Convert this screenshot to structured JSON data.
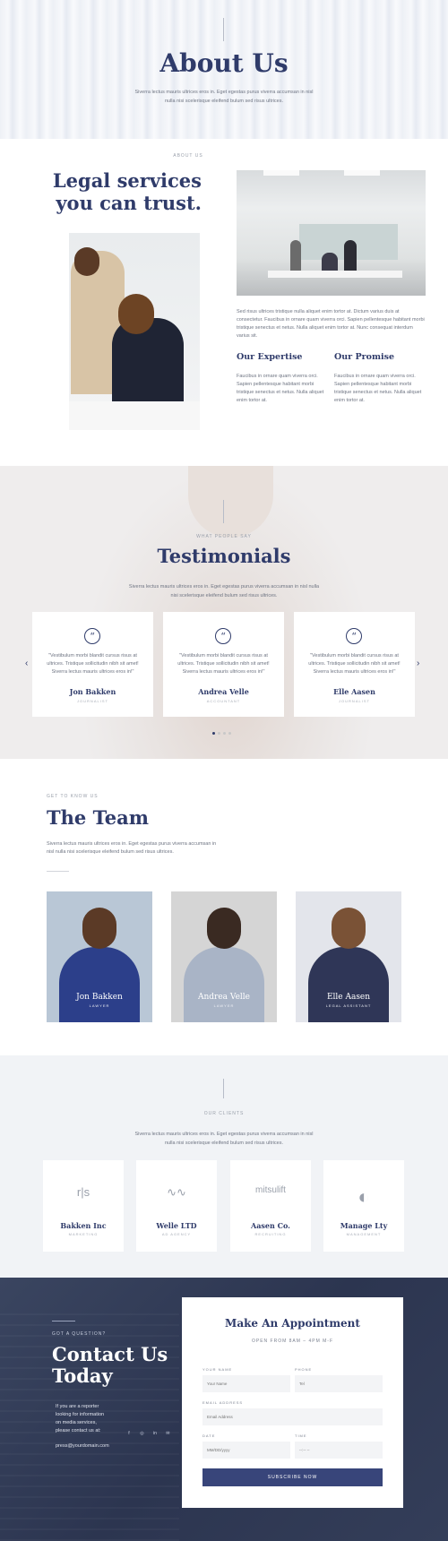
{
  "hero": {
    "title": "About Us",
    "text": "Siverra lectus mauris ultrices eros in. Eget egestas purus viverra accumsan in nisl nulla nisi scelerisque eleifend bulum sed risus ultrices."
  },
  "about": {
    "label": "ABOUT US",
    "title": "Legal services you can trust.",
    "body": "Sed risus ultrices tristique nulla aliquet enim tortor at. Dictum varius duis at consectetur. Faucibus in ornare quam viverra orci. Sapien pellentesque habitant morbi tristique senectus et netus. Nulla aliquet enim tortor at. Nunc consequat interdum varius sit.",
    "features": [
      {
        "title": "Our Expertise",
        "text": "Faucibus in ornare quam viverra orci. Sapien pellentesque habitant morbi tristique senectus et netus. Nulla aliquet enim tortor at."
      },
      {
        "title": "Our Promise",
        "text": "Faucibus in ornare quam viverra orci. Sapien pellentesque habitant morbi tristique senectus et netus. Nulla aliquet enim tortor at."
      }
    ]
  },
  "testimonials": {
    "label": "WHAT PEOPLE SAY",
    "title": "Testimonials",
    "subtitle": "Siverra lectus mauris ultrices eros in. Eget egestas purus viverra accumsan in nisl nulla nisi scelerisque eleifend bulum sed risus ultrices.",
    "quote_glyph": "“",
    "prev_arrow": "‹",
    "next_arrow": "›",
    "items": [
      {
        "quote": "\"Vestibulum morbi blandit cursus risus at ultrices. Tristique sollicitudin nibh sit amet! Siverra lectus mauris ultrices eros in!\"",
        "name": "Jon Bakken",
        "role": "JOURNALIST"
      },
      {
        "quote": "\"Vestibulum morbi blandit cursus risus at ultrices. Tristique sollicitudin nibh sit amet! Siverra lectus mauris ultrices eros in!\"",
        "name": "Andrea Velle",
        "role": "ACCOUNTANT"
      },
      {
        "quote": "\"Vestibulum morbi blandit cursus risus at ultrices. Tristique sollicitudin nibh sit amet! Siverra lectus mauris ultrices eros in!\"",
        "name": "Elle Aasen",
        "role": "JOURNALIST"
      }
    ]
  },
  "team": {
    "label": "GET TO KNOW US",
    "title": "The Team",
    "subtitle": "Siverra lectus mauris ultrices eros in. Eget egestas purus viverra accumsan in nisl nulla nisi scelerisque eleifend bulum sed risus ultrices.",
    "members": [
      {
        "name": "Jon Bakken",
        "role": "LAWYER"
      },
      {
        "name": "Andrea Velle",
        "role": "LAWYER"
      },
      {
        "name": "Elle Aasen",
        "role": "LEGAL ASSISTANT"
      }
    ]
  },
  "clients": {
    "label": "OUR CLIENTS",
    "subtitle": "Siverra lectus mauris ultrices eros in. Eget egestas purus viverra accumsan in nisl nulla nisi scelerisque eleifend bulum sed risus ultrices.",
    "items": [
      {
        "logo": "r|s",
        "name": "Bakken Inc",
        "type": "MARKETING"
      },
      {
        "logo": "∿∿",
        "name": "Welle LTD",
        "type": "AD AGENCY"
      },
      {
        "logo": "mitsulift",
        "name": "Aasen Co.",
        "type": "RECRUITING"
      },
      {
        "logo": "◐",
        "name": "Manage Lty",
        "type": "MANAGEMENT"
      }
    ]
  },
  "contact": {
    "kicker": "GOT A QUESTION?",
    "title": "Contact Us Today",
    "info": "If you are a reporter looking for information on media services, please contact us at:",
    "email": "press@yourdomain.com",
    "socials": [
      "f",
      "◎",
      "in",
      "✉"
    ],
    "form": {
      "title": "Make An Appointment",
      "hours": "OPEN FROM 8AM – 4PM M-F",
      "name_label": "YOUR NAME",
      "name_placeholder": "Your Name",
      "phone_label": "PHONE",
      "phone_placeholder": "Tel",
      "email_label": "EMAIL ADDRESS",
      "email_placeholder": "Email Address",
      "date_label": "DATE",
      "date_placeholder": "MM/DD/yyyy",
      "time_label": "TIME",
      "time_placeholder": "--:-- --",
      "submit": "SUBSCRIBE NOW"
    }
  },
  "colors": {
    "accent": "#2f3b6a",
    "button": "#38457a",
    "dark_bg": "#2c3550"
  }
}
